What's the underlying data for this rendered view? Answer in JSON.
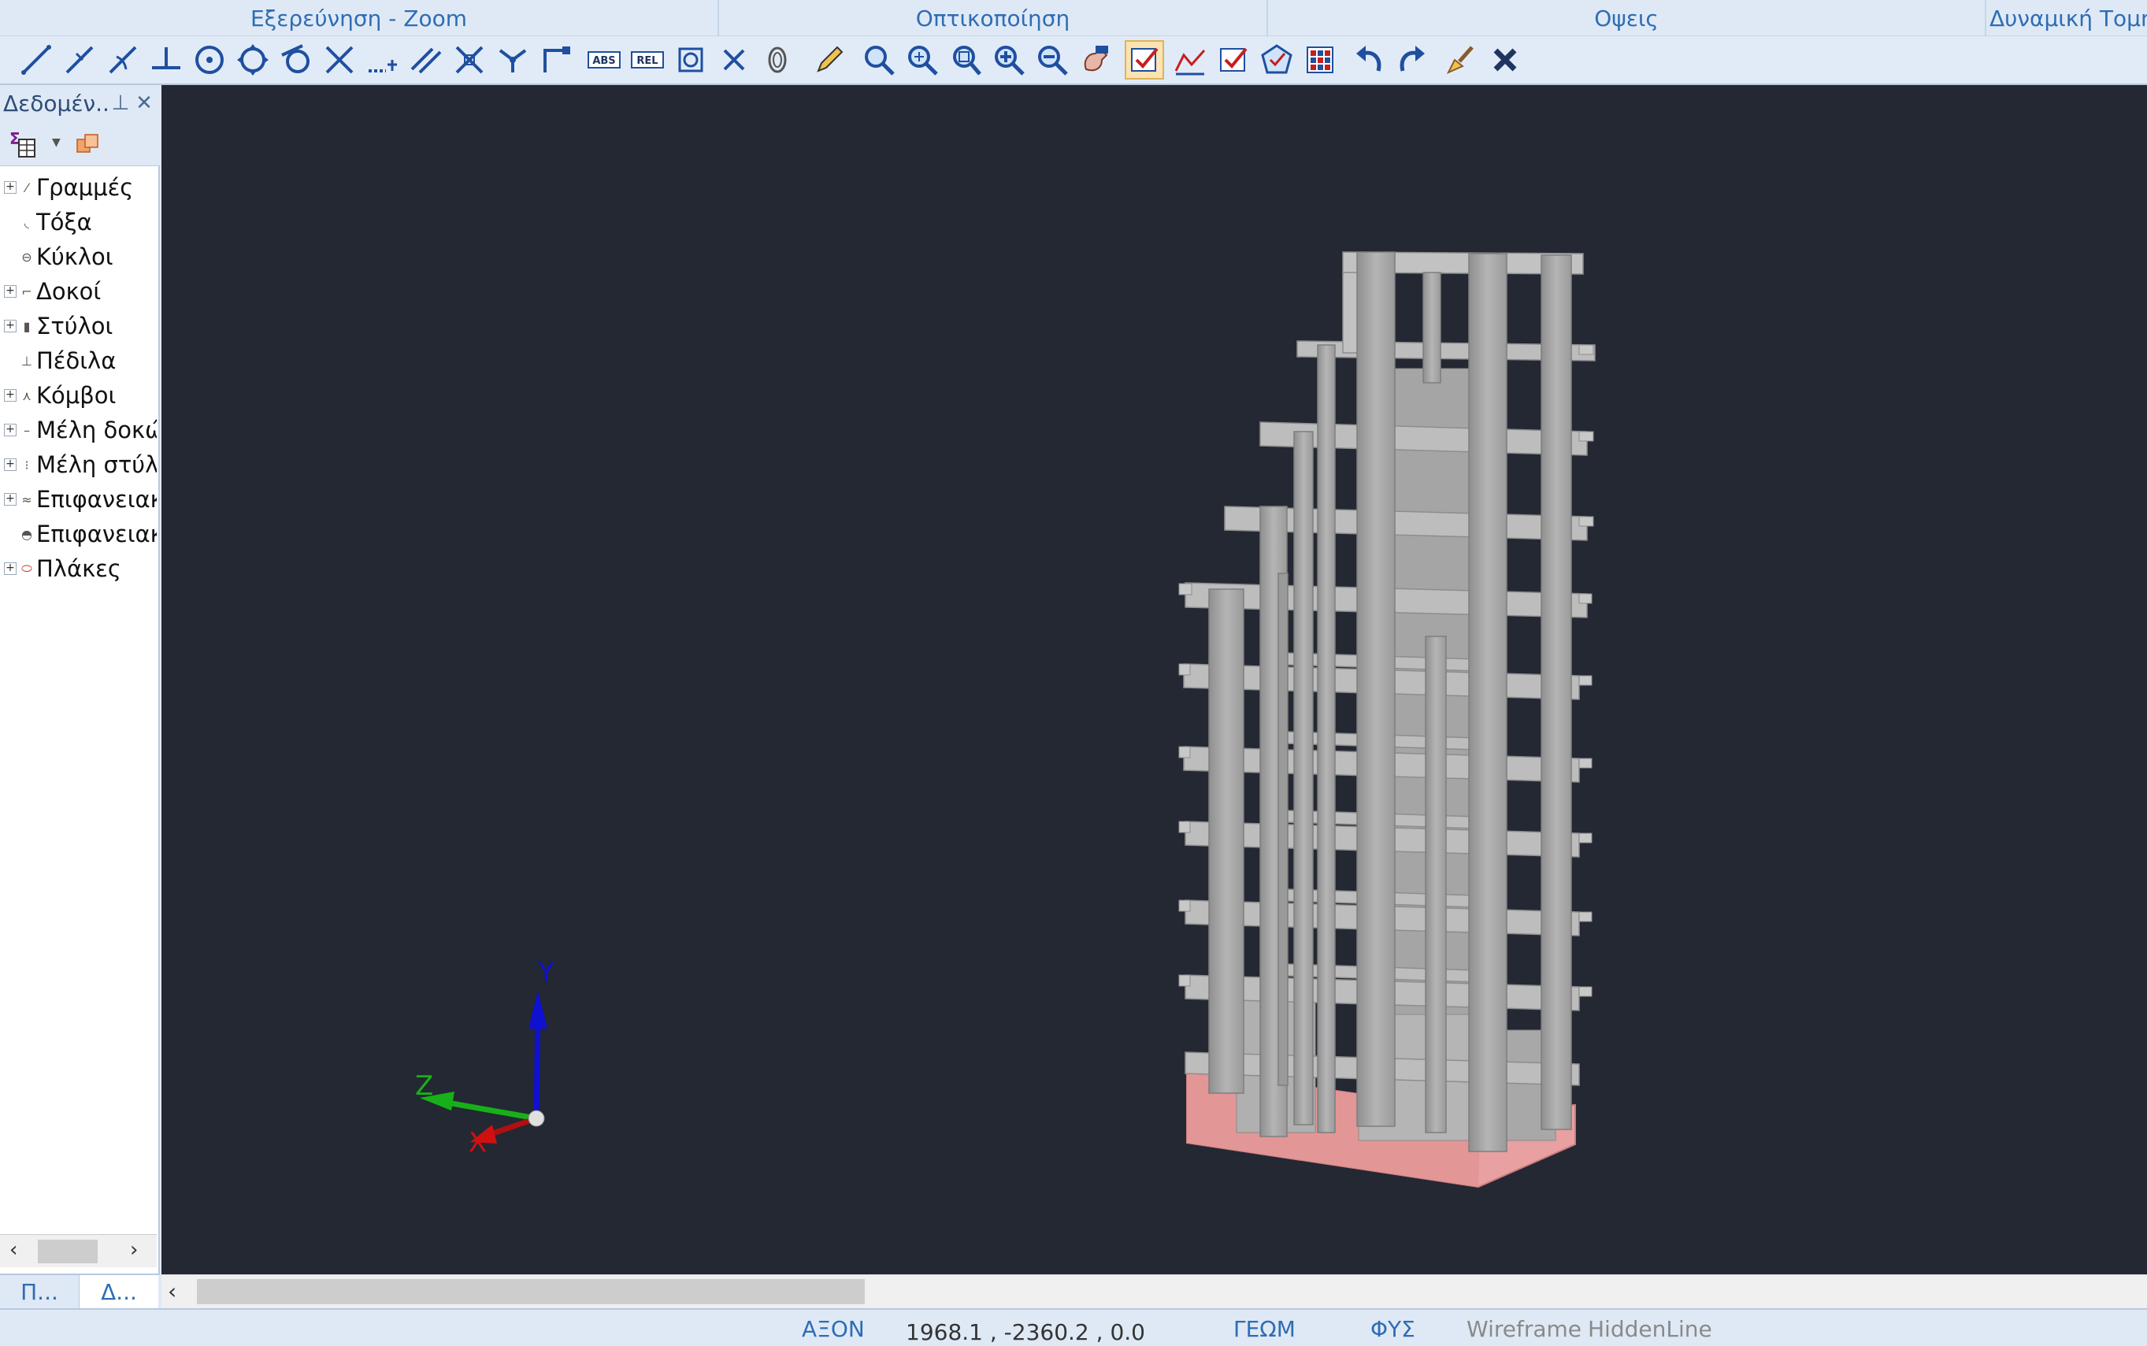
{
  "ribbon": {
    "groups": [
      {
        "label": "Εξερεύνηση - Zoom"
      },
      {
        "label": "Οπτικοποίηση"
      },
      {
        "label": "Οψεις"
      },
      {
        "label": "Δυναμική Τομή"
      }
    ]
  },
  "toolbar": {
    "buttons": [
      {
        "icon": "line-icon"
      },
      {
        "icon": "polyline-icon"
      },
      {
        "icon": "curve-line-icon"
      },
      {
        "icon": "perpendicular-icon"
      },
      {
        "icon": "circle-center-icon"
      },
      {
        "icon": "quadrant-icon"
      },
      {
        "icon": "tangent-icon"
      },
      {
        "icon": "intersection-icon"
      },
      {
        "icon": "extension-icon"
      },
      {
        "icon": "parallel-icon"
      },
      {
        "icon": "apparent-intersection-icon"
      },
      {
        "icon": "node-snap-icon"
      },
      {
        "icon": "corner-icon"
      },
      {
        "icon": "abs-coordinates-icon",
        "text": "ABS"
      },
      {
        "icon": "rel-coordinates-icon",
        "text": "REL"
      },
      {
        "icon": "object-snap-icon"
      },
      {
        "icon": "clear-snap-icon"
      },
      {
        "icon": "fingerprint-icon"
      },
      {
        "icon": "pencil-icon"
      },
      {
        "icon": "zoom-icon"
      },
      {
        "icon": "zoom-extents-icon"
      },
      {
        "icon": "zoom-window-icon"
      },
      {
        "icon": "zoom-in-icon"
      },
      {
        "icon": "zoom-out-icon"
      },
      {
        "icon": "pan-icon"
      },
      {
        "icon": "select-check-icon"
      },
      {
        "icon": "graph-icon"
      },
      {
        "icon": "checkbox-icon"
      },
      {
        "icon": "shape-icon"
      },
      {
        "icon": "grid-colors-icon"
      },
      {
        "icon": "undo-icon"
      },
      {
        "icon": "redo-icon"
      },
      {
        "icon": "brush-icon"
      },
      {
        "icon": "delete-icon"
      }
    ]
  },
  "panel": {
    "title": "Δεδομέν...",
    "tree": [
      {
        "label": "Γραμμές",
        "expandable": true,
        "icon": "line-tree-icon"
      },
      {
        "label": "Τόξα",
        "expandable": false,
        "icon": "arc-tree-icon"
      },
      {
        "label": "Κύκλοι",
        "expandable": false,
        "icon": "circle-tree-icon"
      },
      {
        "label": "Δοκοί",
        "expandable": true,
        "icon": "beam-tree-icon"
      },
      {
        "label": "Στύλοι",
        "expandable": true,
        "icon": "column-tree-icon"
      },
      {
        "label": "Πέδιλα",
        "expandable": false,
        "icon": "footing-tree-icon"
      },
      {
        "label": "Κόμβοι",
        "expandable": true,
        "icon": "node-tree-icon"
      },
      {
        "label": "Μέλη δοκώ",
        "expandable": true,
        "icon": "beam-member-tree-icon"
      },
      {
        "label": "Μέλη στύλω",
        "expandable": true,
        "icon": "column-member-tree-icon"
      },
      {
        "label": "Επιφανειακ",
        "expandable": true,
        "icon": "surface-tree-icon"
      },
      {
        "label": "Επιφανειακ",
        "expandable": false,
        "icon": "surface-load-tree-icon"
      },
      {
        "label": "Πλάκες",
        "expandable": true,
        "icon": "slab-tree-icon"
      }
    ],
    "tabs": [
      {
        "label": "Π..."
      },
      {
        "label": "Δ..."
      }
    ]
  },
  "viewport": {
    "axis": {
      "x": "X",
      "y": "Y",
      "z": "Z"
    }
  },
  "status": {
    "axis_mode": "ΑΞΟΝ",
    "coordinates": "1968.1 , -2360.2 , 0.0",
    "geom": "ΓΕΩΜ",
    "fys": "ΦΥΣ",
    "wireframe": "Wireframe",
    "hiddenline": "HiddenLine"
  },
  "colors": {
    "accent": "#2e6db4",
    "viewport_bg": "#232833",
    "structure": "#a8a8a8",
    "foundation": "#e9a0a0"
  }
}
